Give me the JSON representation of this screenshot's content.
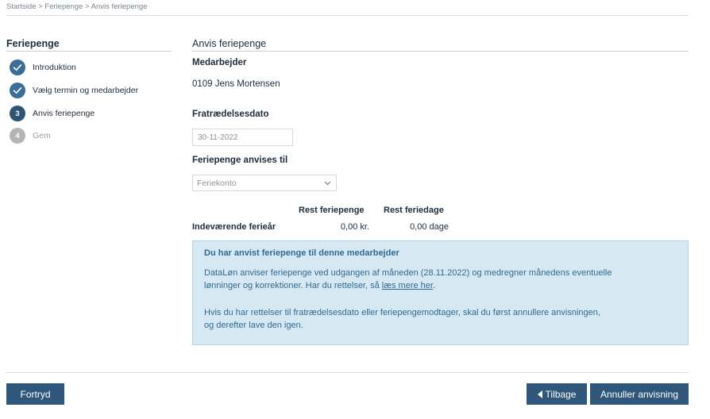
{
  "breadcrumb": "Startside > Feriepenge > Anvis feriepenge",
  "sidebar": {
    "title": "Feriepenge",
    "steps": [
      {
        "label": "Introduktion",
        "state": "done",
        "icon": "check-icon"
      },
      {
        "label": "Vælg termin og medarbejder",
        "state": "done",
        "icon": "check-icon"
      },
      {
        "label": "Anvis feriepenge",
        "state": "current",
        "number": "3"
      },
      {
        "label": "Gem",
        "state": "future",
        "number": "4"
      }
    ]
  },
  "main": {
    "title": "Anvis feriepenge",
    "employee_label": "Medarbejder",
    "employee_value": "0109 Jens Mortensen",
    "resignation_label": "Fratrædelsesdato",
    "resignation_value": "30-11-2022",
    "payout_label": "Feriepenge anvises til",
    "payout_selected": "Feriekonto",
    "table": {
      "headers": [
        "Rest feriepenge",
        "Rest feriedage"
      ],
      "row_label": "Indeværende ferieår",
      "row_values": [
        "0,00 kr.",
        "0,00 dage"
      ]
    },
    "info": {
      "title": "Du har anvist feriepenge til denne medarbejder",
      "p1_line1": "DataLøn anviser feriepenge ved udgangen af måneden (28.11.2022) og medregner månedens eventuelle",
      "p1_line2_prefix": "lønninger og korrektioner. Har du rettelser, så ",
      "p1_link": "læs mere her",
      "p1_suffix": ".",
      "p2_line1": "Hvis du har rettelser til fratrædelsesdato eller feriepengemodtager, skal du først annullere anvisningen,",
      "p2_line2": "og derefter lave den igen."
    }
  },
  "footer": {
    "cancel_label": "Fortryd",
    "back_label": "Tilbage",
    "annul_label": "Annuller anvisning"
  },
  "colors": {
    "primary": "#2f577b",
    "info_bg": "#d6e9f3",
    "info_text": "#2f6a94"
  }
}
